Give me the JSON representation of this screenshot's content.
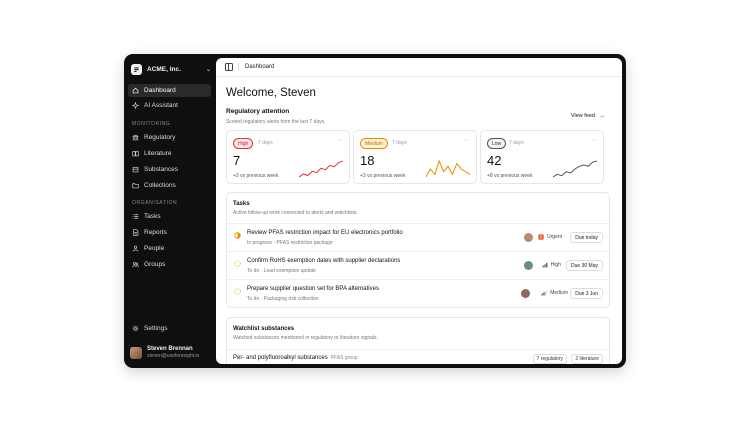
{
  "sidebar": {
    "org_name": "ACME, Inc.",
    "items_top": [
      {
        "label": "Dashboard",
        "icon": "home-icon"
      },
      {
        "label": "AI Assistant",
        "icon": "sparkle-icon"
      }
    ],
    "section_monitoring": "MONITORING",
    "items_monitoring": [
      {
        "label": "Regulatory",
        "icon": "landmark-icon"
      },
      {
        "label": "Literature",
        "icon": "book-icon"
      },
      {
        "label": "Substances",
        "icon": "flask-icon"
      },
      {
        "label": "Collections",
        "icon": "folder-icon"
      }
    ],
    "section_organisation": "ORGANISATION",
    "items_organisation": [
      {
        "label": "Tasks",
        "icon": "list-icon"
      },
      {
        "label": "Reports",
        "icon": "file-icon"
      },
      {
        "label": "People",
        "icon": "user-icon"
      },
      {
        "label": "Groups",
        "icon": "users-icon"
      }
    ],
    "settings_label": "Settings",
    "user": {
      "name": "Steven Brennan",
      "email": "steven@useforesight.io"
    }
  },
  "topbar": {
    "breadcrumb": "Dashboard"
  },
  "main": {
    "welcome": "Welcome, Steven",
    "regulatory": {
      "title": "Regulatory attention",
      "subtitle": "Scored regulatory alerts from the last 7 days.",
      "view_feed": "View feed",
      "cards": [
        {
          "badge": "High",
          "days": "7 days",
          "count": "7",
          "delta": "+3 vs previous week",
          "color": "#e0303a",
          "badge_bg": "#fde7e7",
          "badge_fg": "#c4202a",
          "spark": [
            3,
            4,
            3.5,
            5,
            4.5,
            6,
            5.5,
            7,
            6.5,
            8,
            8.5
          ]
        },
        {
          "badge": "Medium",
          "days": "7 days",
          "count": "18",
          "delta": "+3 vs previous week",
          "color": "#f08c00",
          "badge_bg": "#fff1d6",
          "badge_fg": "#b76b00",
          "spark": [
            2,
            5,
            3,
            8,
            4,
            6,
            3,
            7,
            5,
            4,
            3
          ]
        },
        {
          "badge": "Low",
          "days": "7 days",
          "count": "42",
          "delta": "+8 vs previous week",
          "color": "#555555",
          "badge_bg": "#f2f2f2",
          "badge_fg": "#333333",
          "spark": [
            2,
            3,
            2.5,
            4,
            3.5,
            5,
            6,
            6.5,
            6,
            7.5,
            8
          ]
        }
      ]
    },
    "tasks": {
      "title": "Tasks",
      "subtitle": "Active follow-up work connected to alerts and watchlists.",
      "items": [
        {
          "title": "Review PFAS restriction impact for EU electronics portfolio",
          "meta": "In progress · PFAS restriction package",
          "priority": "Urgent",
          "due": "Due today",
          "status_color": "#f08c00"
        },
        {
          "title": "Confirm RoHS exemption dates with supplier declarations",
          "meta": "To do · Lead exemption update",
          "priority": "High",
          "due": "Due 30 May",
          "status_color": "#f0b400"
        },
        {
          "title": "Prepare supplier question set for BPA alternatives",
          "meta": "To do · Packaging risk collection",
          "priority": "Medium",
          "due": "Due 3 Jun",
          "status_color": "#f0b400"
        }
      ]
    },
    "watchlist": {
      "title": "Watchlist substances",
      "subtitle": "Watched substances mentioned in regulatory or literature signals.",
      "rows": [
        {
          "name": "Per- and polyfluoroalkyl substances",
          "group": "PFAS group",
          "regulatory": "7 regulatory",
          "literature": "2 literature"
        }
      ]
    }
  }
}
